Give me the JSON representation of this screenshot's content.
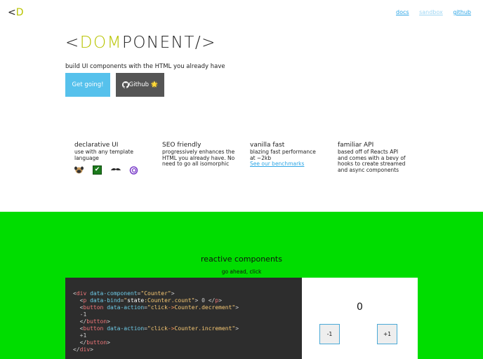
{
  "header": {
    "logo_text": "<",
    "logo_accent": "D",
    "nav": [
      "docs",
      "sandbox",
      "github"
    ]
  },
  "hero": {
    "brand_open": "<",
    "brand_accent": "DOM",
    "brand_rest": "PONENT/>",
    "tagline": "build UI components with the HTML you already have",
    "btn_go": "Get going!",
    "btn_github": "Github",
    "btn_github_emoji": "🌟"
  },
  "features": [
    {
      "title": "declarative UI",
      "text": "use with any template language"
    },
    {
      "title": "SEO friendly",
      "text": "progressively enhances the HTML you already have. No need to go all isomorphic"
    },
    {
      "title": "vanilla fast",
      "text": "blazing fast performance at ~2kb",
      "link": "See our benchmarks"
    },
    {
      "title": "familiar API",
      "text": "based off of Reacts API and comes with a bevy of hooks to create streamed and async components"
    }
  ],
  "template_icons": [
    "pug-icon",
    "check-icon",
    "mustache-icon",
    "spiral-icon"
  ],
  "reactive": {
    "title": "reactive components",
    "subtitle": "go ahead, click",
    "count": "0",
    "dec_label": "-1",
    "inc_label": "+1"
  },
  "colors": {
    "accent": "#b8c400",
    "primary_button": "#56c1ec",
    "dark_button": "#555555",
    "green_section": "#00dd00",
    "code_bg": "#2d2d2d"
  }
}
